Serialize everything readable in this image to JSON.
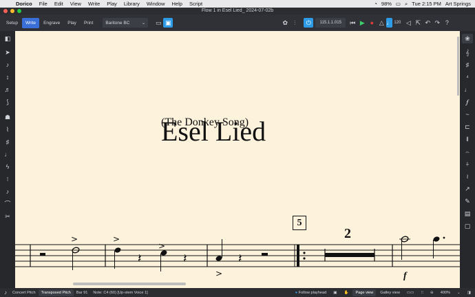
{
  "menubar": {
    "app": "Dorico",
    "items": [
      "File",
      "Edit",
      "View",
      "Write",
      "Play",
      "Library",
      "Window",
      "Help",
      "Script"
    ],
    "battery": "98%",
    "clock": "Tue 2:15 PM",
    "user": "Art Springs"
  },
  "window": {
    "title": "Flow 1 in Esel Lied_ 2024-07-02b"
  },
  "toolbar": {
    "modes": [
      "Setup",
      "Write",
      "Engrave",
      "Play",
      "Print"
    ],
    "layout": "Baritone BC",
    "timecode": "115.1.1.015",
    "tempo": "120"
  },
  "score": {
    "title": "Esel Lied",
    "subtitle": "(The Donkey Song)",
    "rehearsal_mark": "5",
    "multirest_count": "2",
    "dynamic": "f"
  },
  "statusbar": {
    "concert_pitch": "Concert Pitch",
    "transposed_pitch": "Transposed Pitch",
    "bar": "Bar 91",
    "note_info": "Note: C4 (60) [Up-stem Voice 1]",
    "follow_playhead": "Follow playhead",
    "page_view": "Page view",
    "galley_view": "Galley view",
    "zoom": "400%"
  },
  "colors": {
    "accent": "#3a6fd8",
    "paper": "#fdf2dc",
    "chrome": "#2f3136"
  }
}
